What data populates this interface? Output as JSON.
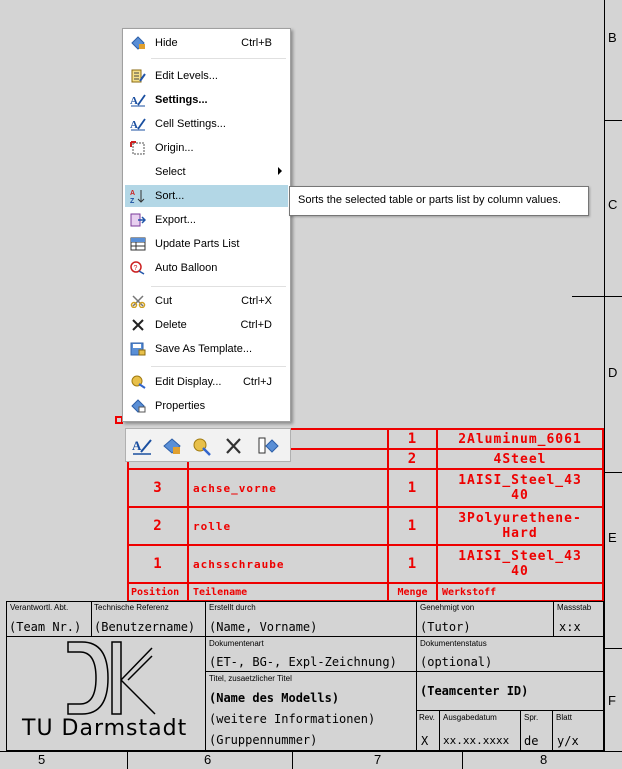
{
  "menu": {
    "items": [
      {
        "label": "Hide",
        "shortcut": "Ctrl+B",
        "icon": "hide-icon"
      },
      {
        "label": "Edit Levels...",
        "shortcut": "",
        "icon": "edit-levels-icon"
      },
      {
        "label": "Settings...",
        "shortcut": "",
        "icon": "settings-icon"
      },
      {
        "label": "Cell Settings...",
        "shortcut": "",
        "icon": "cell-settings-icon"
      },
      {
        "label": "Origin...",
        "shortcut": "",
        "icon": "origin-icon"
      },
      {
        "label": "Select",
        "shortcut": "",
        "icon": ""
      },
      {
        "label": "Sort...",
        "shortcut": "",
        "icon": "sort-icon"
      },
      {
        "label": "Export...",
        "shortcut": "",
        "icon": "export-icon"
      },
      {
        "label": "Update Parts List",
        "shortcut": "",
        "icon": "update-parts-list-icon"
      },
      {
        "label": "Auto Balloon",
        "shortcut": "",
        "icon": "auto-balloon-icon"
      },
      {
        "label": "Cut",
        "shortcut": "Ctrl+X",
        "icon": "cut-icon"
      },
      {
        "label": "Delete",
        "shortcut": "Ctrl+D",
        "icon": "delete-icon"
      },
      {
        "label": "Save As Template...",
        "shortcut": "",
        "icon": "save-template-icon"
      },
      {
        "label": "Edit Display...",
        "shortcut": "Ctrl+J",
        "icon": "edit-display-icon"
      },
      {
        "label": "Properties",
        "shortcut": "",
        "icon": "properties-icon"
      }
    ],
    "tooltip": "Sorts the selected table or parts list by column values."
  },
  "zones": {
    "letters": [
      "B",
      "C",
      "D",
      "E",
      "F"
    ],
    "numbers": [
      "5",
      "6",
      "7",
      "8"
    ]
  },
  "parts_list": {
    "rows": [
      {
        "pos": "",
        "name": "",
        "qty": "1",
        "mat": "2Aluminum_6061"
      },
      {
        "pos": "",
        "name": "",
        "qty": "2",
        "mat": "4Steel"
      },
      {
        "pos": "3",
        "name": "achse_vorne",
        "qty": "1",
        "mat": "1AISI_Steel_43",
        "mat2": "40"
      },
      {
        "pos": "2",
        "name": "rolle",
        "qty": "1",
        "mat": "3Polyurethene-",
        "mat2": "Hard"
      },
      {
        "pos": "1",
        "name": "achsschraube",
        "qty": "1",
        "mat": "1AISI_Steel_43",
        "mat2": "40"
      }
    ],
    "header": {
      "pos": "Position",
      "name": "Teilename",
      "qty": "Menge",
      "mat": "Werkstoff"
    }
  },
  "title_block": {
    "verantwortl_label": "Verantwortl. Abt.",
    "verantwortl_value": "(Team Nr.)",
    "tech_ref_label": "Technische Referenz",
    "tech_ref_value": "(Benutzername)",
    "erstellt_label": "Erstellt durch",
    "erstellt_value": "(Name, Vorname)",
    "genehmigt_label": "Genehmigt von",
    "genehmigt_value": "(Tutor)",
    "massstab_label": "Massstab",
    "massstab_value": "x:x",
    "dokart_label": "Dokumentenart",
    "dokart_value": "(ET-, BG-, Expl-Zeichnung)",
    "dokstatus_label": "Dokumentenstatus",
    "dokstatus_value": "(optional)",
    "titel_label": "Titel, zusaetzlicher Titel",
    "titel_line1": "(Name des Modells)",
    "titel_line2": "(weitere Informationen)",
    "titel_line3": "(Gruppennummer)",
    "teamcenter_value": "(Teamcenter ID)",
    "rev_label": "Rev.",
    "rev_value": "X",
    "ausgabe_label": "Ausgabedatum",
    "ausgabe_value": "xx.xx.xxxx",
    "spr_label": "Spr.",
    "spr_value": "de",
    "blatt_label": "Blatt",
    "blatt_value": "y/x",
    "logo_text": "TU Darmstadt"
  }
}
